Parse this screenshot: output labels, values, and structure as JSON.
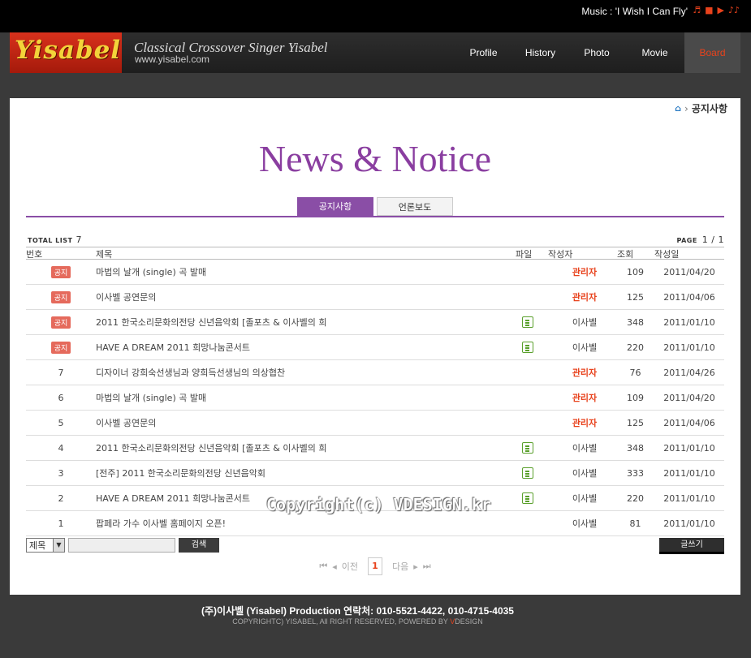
{
  "music": {
    "label": "Music :",
    "title": "'I Wish I Can Fly'"
  },
  "logo": "Yisabel",
  "tagline": "Classical Crossover Singer Yisabel",
  "site_url": "www.yisabel.com",
  "nav": [
    {
      "label": "Profile"
    },
    {
      "label": "History"
    },
    {
      "label": "Photo"
    },
    {
      "label": "Movie"
    },
    {
      "label": "Board"
    }
  ],
  "breadcrumb": {
    "current": "공지사항"
  },
  "page_title": "News & Notice",
  "tabs": [
    {
      "label": "공지사항"
    },
    {
      "label": "언론보도"
    }
  ],
  "summary": {
    "total_label": "TOTAL LIST",
    "total": "7",
    "page_label": "PAGE",
    "page": "1 / 1"
  },
  "table": {
    "headers": {
      "no": "번호",
      "subject": "제목",
      "file": "파일",
      "writer": "작성자",
      "views": "조회",
      "date": "작성일"
    },
    "notice_label": "공지",
    "rows": [
      {
        "no": "공지",
        "notice": true,
        "subject": "마법의 날개 (single) 곡 발매",
        "file": false,
        "writer": "관리자",
        "admin": true,
        "views": "109",
        "date": "2011/04/20"
      },
      {
        "no": "공지",
        "notice": true,
        "subject": "이사벨 공연문의",
        "file": false,
        "writer": "관리자",
        "admin": true,
        "views": "125",
        "date": "2011/04/06"
      },
      {
        "no": "공지",
        "notice": true,
        "subject": "2011 한국소리문화의전당 신년음악회 [졸포츠 & 이사벨의 희",
        "file": true,
        "writer": "이사벨",
        "admin": false,
        "views": "348",
        "date": "2011/01/10"
      },
      {
        "no": "공지",
        "notice": true,
        "subject": "HAVE A DREAM 2011 희망나눔콘서트",
        "file": true,
        "writer": "이사벨",
        "admin": false,
        "views": "220",
        "date": "2011/01/10"
      },
      {
        "no": "7",
        "notice": false,
        "subject": "디자이너 강희숙선생님과 양희득선생님의 의상협찬",
        "file": false,
        "writer": "관리자",
        "admin": true,
        "views": "76",
        "date": "2011/04/26"
      },
      {
        "no": "6",
        "notice": false,
        "subject": "마법의 날개 (single) 곡 발매",
        "file": false,
        "writer": "관리자",
        "admin": true,
        "views": "109",
        "date": "2011/04/20"
      },
      {
        "no": "5",
        "notice": false,
        "subject": "이사벨 공연문의",
        "file": false,
        "writer": "관리자",
        "admin": true,
        "views": "125",
        "date": "2011/04/06"
      },
      {
        "no": "4",
        "notice": false,
        "subject": "2011 한국소리문화의전당 신년음악회 [졸포츠 & 이사벨의 희",
        "file": true,
        "writer": "이사벨",
        "admin": false,
        "views": "348",
        "date": "2011/01/10"
      },
      {
        "no": "3",
        "notice": false,
        "subject": "[전주] 2011 한국소리문화의전당 신년음악회",
        "file": true,
        "writer": "이사벨",
        "admin": false,
        "views": "333",
        "date": "2011/01/10"
      },
      {
        "no": "2",
        "notice": false,
        "subject": "HAVE A DREAM 2011 희망나눔콘서트",
        "file": true,
        "writer": "이사벨",
        "admin": false,
        "views": "220",
        "date": "2011/01/10"
      },
      {
        "no": "1",
        "notice": false,
        "subject": "팝페라 가수 이사벨 홈페이지 오픈!",
        "file": false,
        "writer": "이사벨",
        "admin": false,
        "views": "81",
        "date": "2011/01/10"
      }
    ]
  },
  "search": {
    "select_value": "제목",
    "button": "검색",
    "input_value": ""
  },
  "write_button": "글쓰기",
  "pager": {
    "prev": "이전",
    "next": "다음",
    "current": "1"
  },
  "watermark": "Copyright(c) VDESIGN.kr",
  "footer": {
    "line1": "(주)이사벨 (Yisabel) Production 연락처: 010-5521-4422, 010-4715-4035",
    "line2": "COPYRIGHTC) YISABEL, All RIGHT RESERVED, POWERED BY",
    "brand_letter": "V",
    "brand_rest": "DESIGN"
  }
}
